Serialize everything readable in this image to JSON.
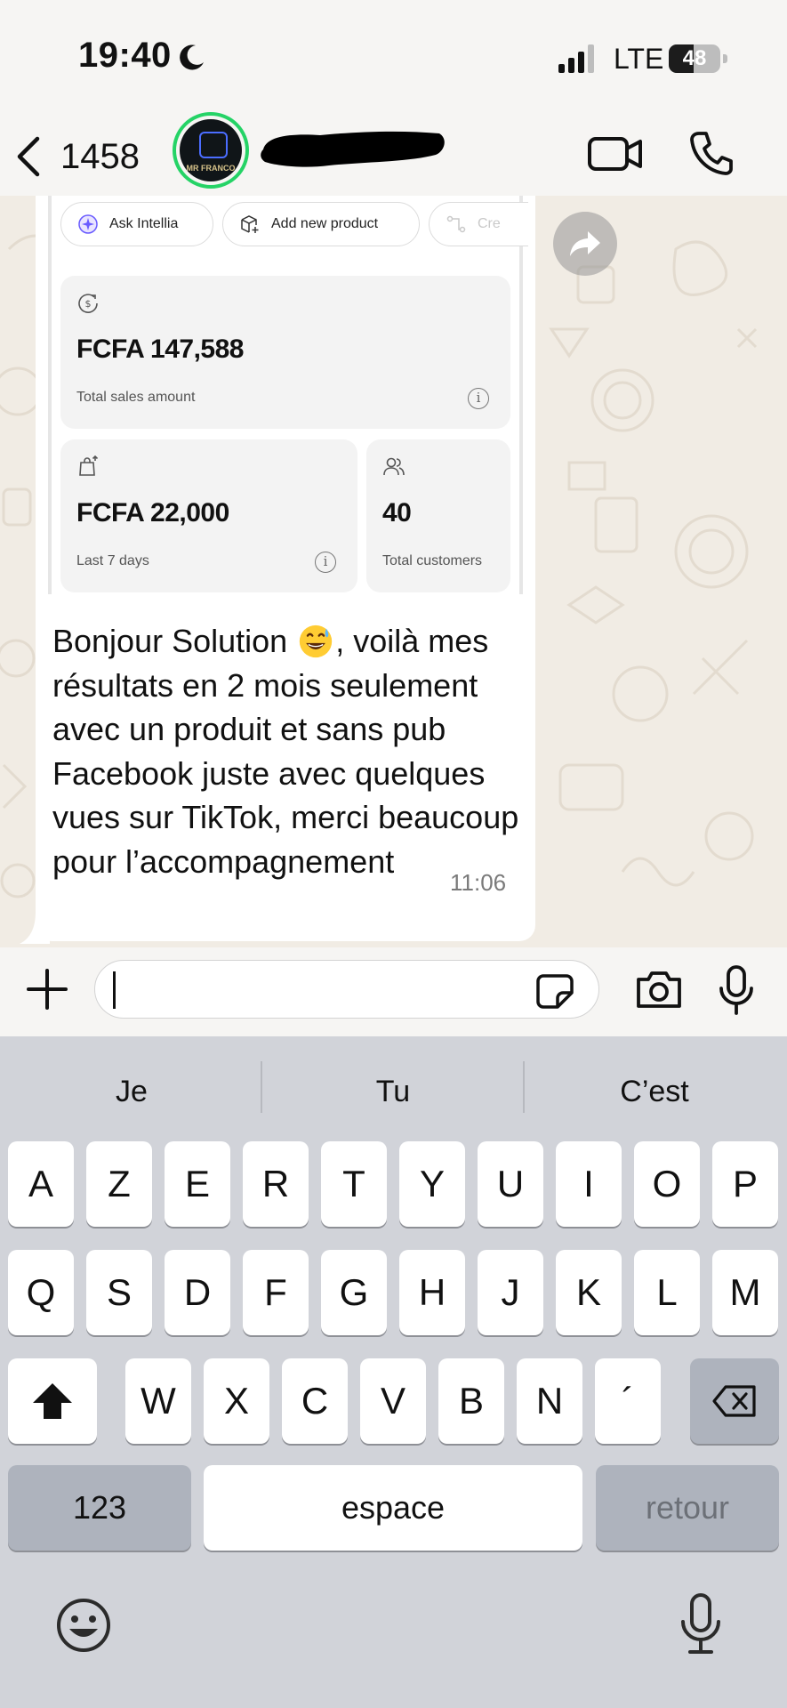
{
  "status_bar": {
    "time": "19:40",
    "network": "LTE",
    "battery": "48",
    "battery_level": 0.48,
    "icons": [
      "moon-icon",
      "signal-icon",
      "battery-icon"
    ]
  },
  "header": {
    "back_count": "1458",
    "avatar_text": "MR FRANCO",
    "icons": [
      "chevron-left-icon",
      "video-camera-icon",
      "phone-icon"
    ]
  },
  "message": {
    "screenshot": {
      "actions": [
        "Ask Intellia",
        "Add new product",
        "Cre"
      ],
      "cards": {
        "sales_amount": "FCFA 147,588",
        "sales_label": "Total sales amount",
        "week_amount": "FCFA 22,000",
        "week_label": "Last 7 days",
        "customers": "40",
        "customers_label": "Total customers"
      }
    },
    "text_1": "Bonjour Solution ",
    "text_2": ", voilà mes résultats en 2 mois seulement avec un produit et sans pub Facebook juste avec quelques vues sur TikTok, merci beaucoup pour l’accompagnement",
    "emoji": "grinning-face-with-sweat",
    "time": "11:06"
  },
  "input": {
    "value": "",
    "icons": [
      "plus-icon",
      "sticker-icon",
      "camera-icon",
      "microphone-icon"
    ]
  },
  "keyboard": {
    "suggestions": [
      "Je",
      "Tu",
      "C’est"
    ],
    "row1": [
      "A",
      "Z",
      "E",
      "R",
      "T",
      "Y",
      "U",
      "I",
      "O",
      "P"
    ],
    "row2": [
      "Q",
      "S",
      "D",
      "F",
      "G",
      "H",
      "J",
      "K",
      "L",
      "M"
    ],
    "row3": [
      "W",
      "X",
      "C",
      "V",
      "B",
      "N",
      "´"
    ],
    "numbers_key": "123",
    "space_key": "espace",
    "return_key": "retour",
    "icons": [
      "shift-icon",
      "delete-icon",
      "emoji-icon",
      "dictation-icon"
    ]
  },
  "colors": {
    "accent_green": "#25d366",
    "chat_background": "#f1ece4",
    "keyboard_background": "#d1d3d9"
  }
}
